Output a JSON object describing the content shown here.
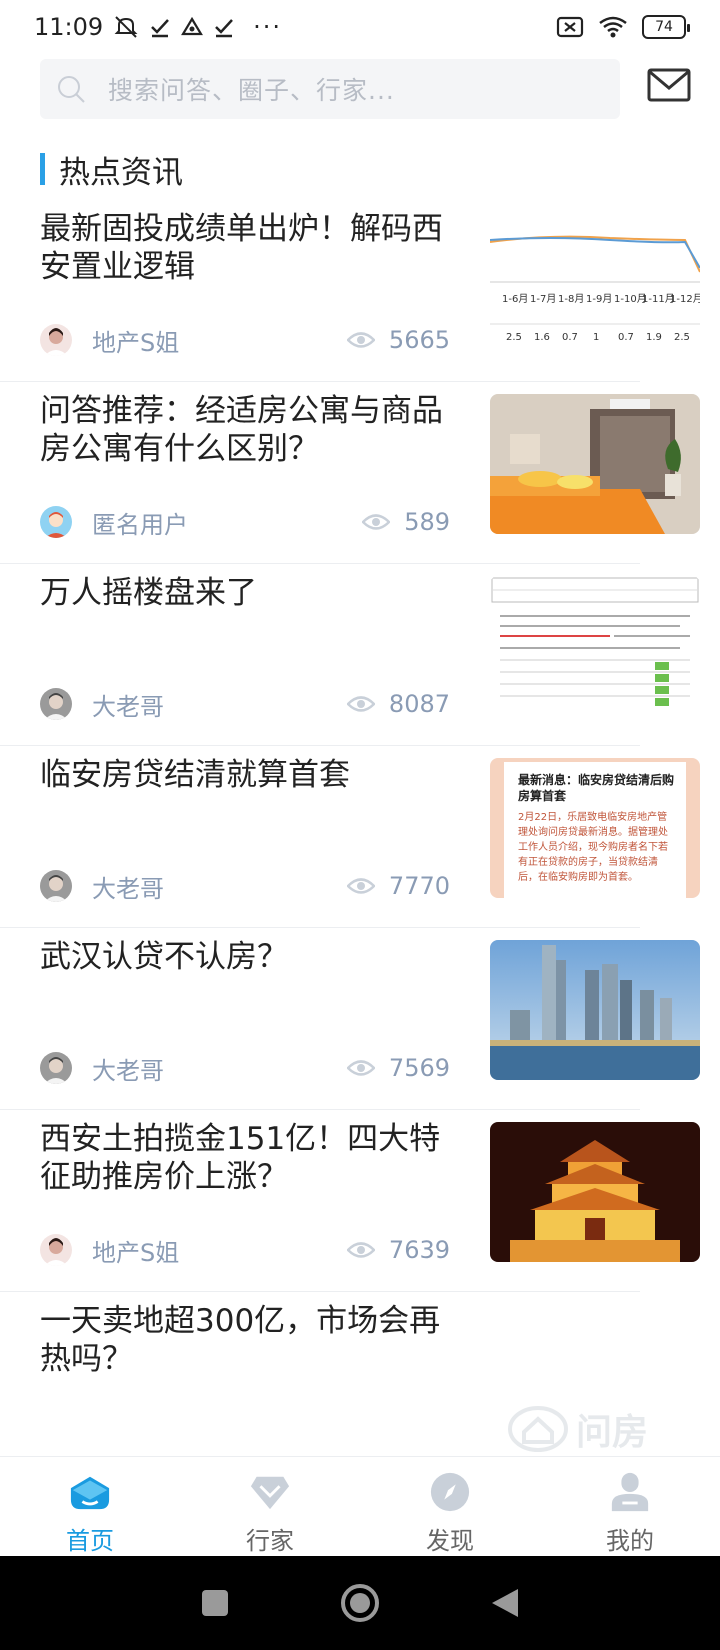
{
  "status_bar": {
    "time": "11:09",
    "dots": "···",
    "battery": "74"
  },
  "search": {
    "placeholder": "搜索问答、圈子、行家..."
  },
  "section": {
    "title": "热点资讯"
  },
  "feed": [
    {
      "title": "最新固投成绩单出炉！解码西安置业逻辑",
      "author": "地产S姐",
      "views": "5665"
    },
    {
      "title": "问答推荐：经适房公寓与商品房公寓有什么区别？",
      "author": "匿名用户",
      "views": "589"
    },
    {
      "title": "万人摇楼盘来了",
      "author": "大老哥",
      "views": "8087"
    },
    {
      "title": "临安房贷结清就算首套",
      "author": "大老哥",
      "views": "7770"
    },
    {
      "title": "武汉认贷不认房？",
      "author": "大老哥",
      "views": "7569"
    },
    {
      "title": "西安土拍揽金151亿！四大特征助推房价上涨？",
      "author": "地产S姐",
      "views": "7639"
    },
    {
      "title": "一天卖地超300亿，市场会再热吗？"
    }
  ],
  "thumb_texts": {
    "chart_headers": [
      "1-6月",
      "1-7月",
      "1-8月",
      "1-9月",
      "1-10月",
      "1-11月",
      "1-12月"
    ],
    "chart_values": [
      "2.5",
      "1.6",
      "0.7",
      "1",
      "0.7",
      "1.9",
      "2.5"
    ],
    "news_headline": "最新消息：临安房贷结清后购房算首套",
    "news_body": "2月22日，乐居致电临安房地产管理处询问房贷最新消息。据管理处工作人员介绍，现今购房者名下若有正在贷款的房子，当贷款结清后，在临安购房即为首套。"
  },
  "watermark": {
    "text": "问房"
  },
  "bottom_nav": [
    {
      "label": "首页",
      "active": true
    },
    {
      "label": "行家",
      "active": false
    },
    {
      "label": "发现",
      "active": false
    },
    {
      "label": "我的",
      "active": false
    }
  ],
  "colors": {
    "accent": "#1a9be0",
    "meta": "#8a9bb4",
    "nav_inactive": "#c9d0d9"
  }
}
